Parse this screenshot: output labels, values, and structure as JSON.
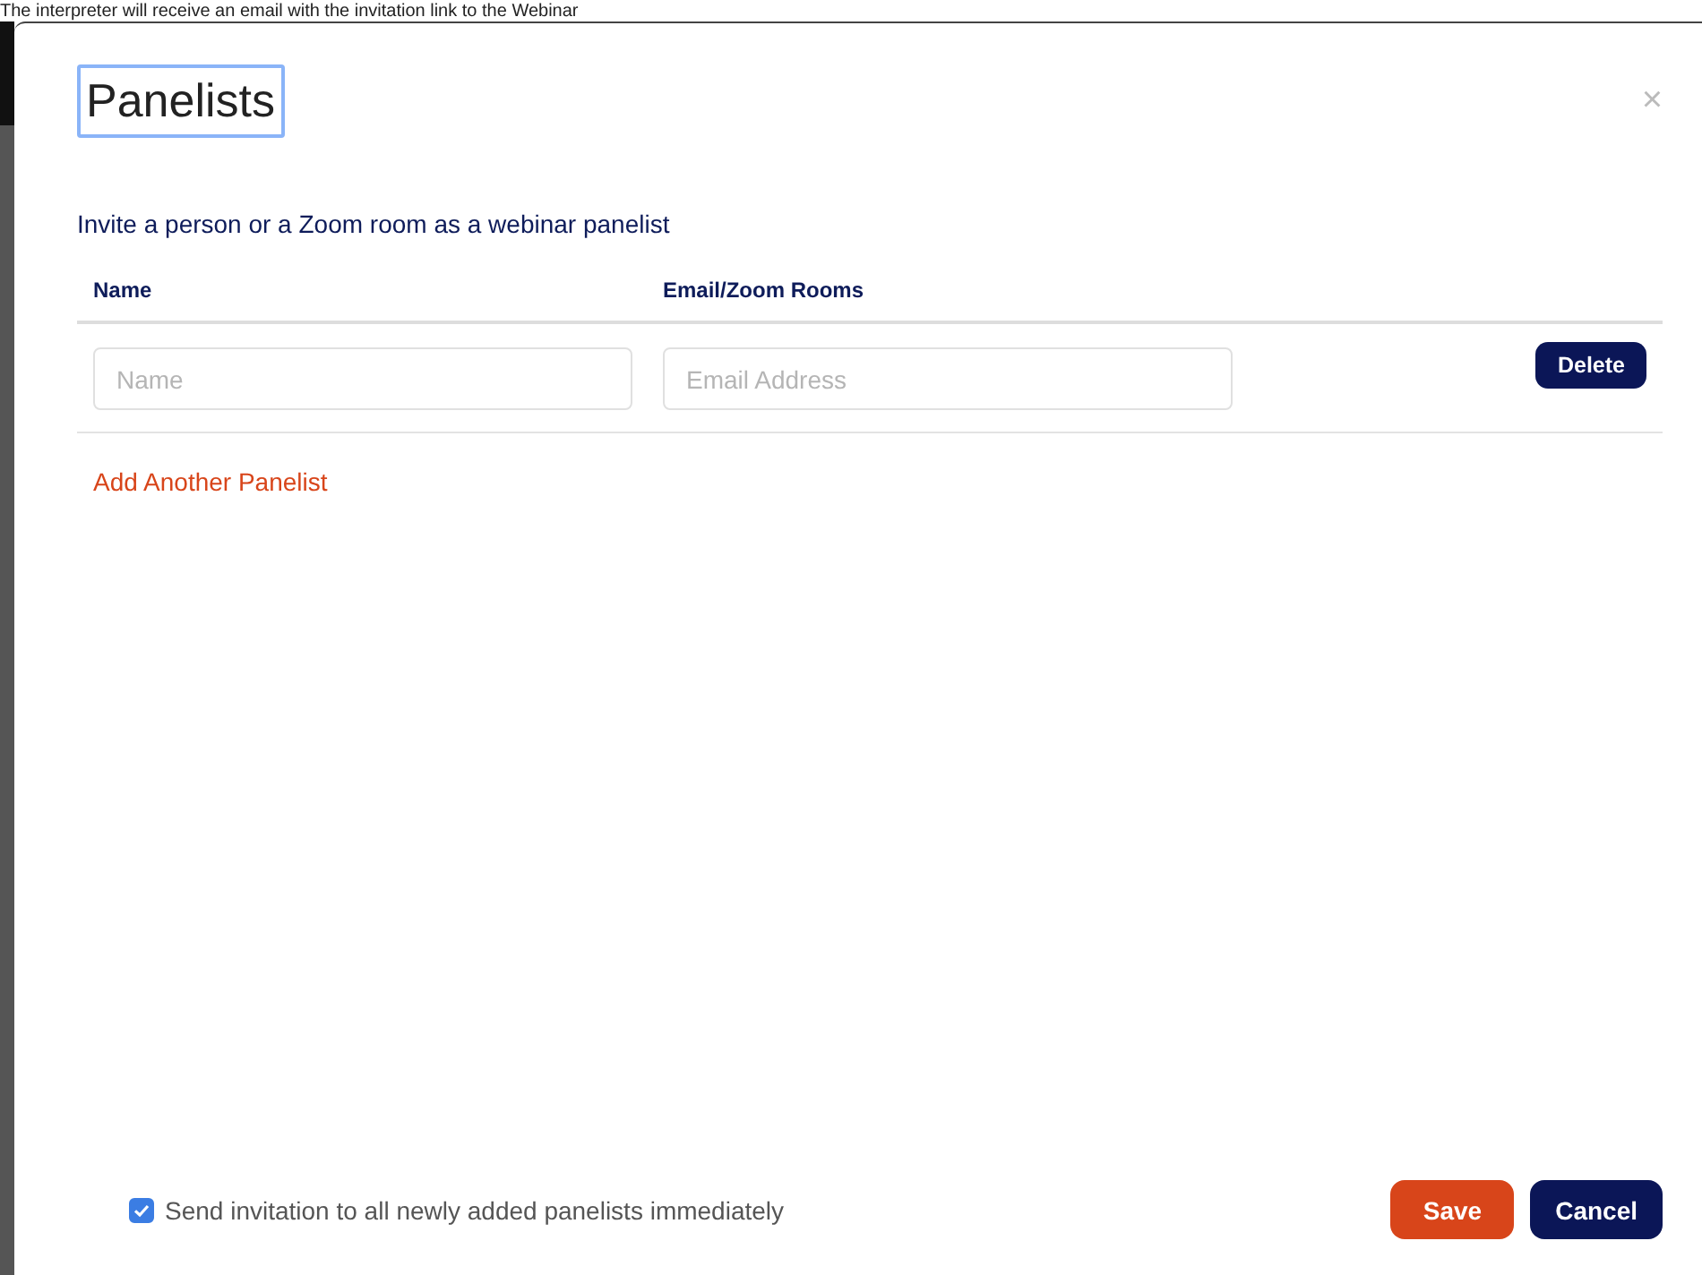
{
  "background_text": "The interpreter will receive an email with the invitation link to the Webinar",
  "dialog": {
    "title": "Panelists",
    "close": "×",
    "subtitle": "Invite a person or a Zoom room as a webinar panelist",
    "columns": [
      "Name",
      "Email/Zoom Rooms"
    ],
    "rows": [
      {
        "name_placeholder": "Name",
        "email_placeholder": "Email Address",
        "delete": "Delete"
      }
    ],
    "add_link": "Add Another Panelist",
    "send_invitation": {
      "label": "Send invitation to all newly added panelists immediately",
      "checked": true
    },
    "buttons": [
      {
        "label": "Save",
        "kind": "primary"
      },
      {
        "label": "Cancel",
        "kind": "secondary"
      }
    ]
  }
}
